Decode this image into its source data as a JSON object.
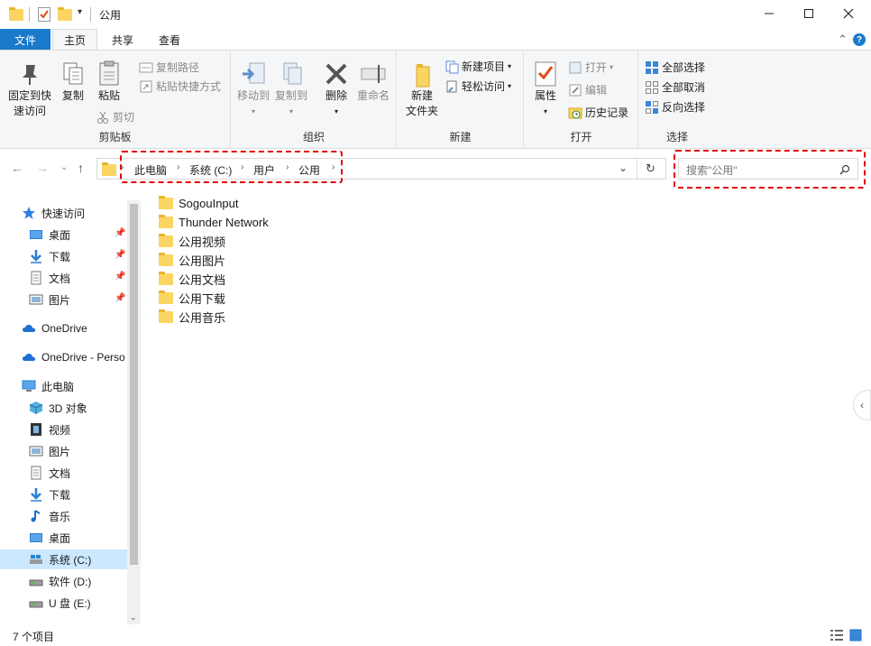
{
  "window": {
    "title": "公用"
  },
  "tabs": {
    "file": "文件",
    "home": "主页",
    "share": "共享",
    "view": "查看"
  },
  "ribbon": {
    "clipboard": {
      "label": "剪贴板",
      "pin_quick_line1": "固定到快",
      "pin_quick_line2": "速访问",
      "copy": "复制",
      "paste": "粘贴",
      "copy_path": "复制路径",
      "paste_shortcut": "粘贴快捷方式",
      "cut": "剪切"
    },
    "organize": {
      "label": "组织",
      "move_to": "移动到",
      "copy_to": "复制到",
      "delete": "删除",
      "rename": "重命名"
    },
    "new": {
      "label": "新建",
      "new_folder_line1": "新建",
      "new_folder_line2": "文件夹",
      "new_item": "新建项目",
      "easy_access": "轻松访问"
    },
    "open": {
      "label": "打开",
      "properties": "属性",
      "open": "打开",
      "edit": "编辑",
      "history": "历史记录"
    },
    "select": {
      "label": "选择",
      "select_all": "全部选择",
      "select_none": "全部取消",
      "invert": "反向选择"
    }
  },
  "address": {
    "crumbs": [
      "此电脑",
      "系统 (C:)",
      "用户",
      "公用"
    ],
    "search_placeholder": "搜索\"公用\""
  },
  "sidebar": {
    "quick_access": "快速访问",
    "quick_items": [
      "桌面",
      "下载",
      "文档",
      "图片"
    ],
    "onedrive": "OneDrive",
    "onedrive_personal": "OneDrive - Perso",
    "this_pc": "此电脑",
    "pc_items": [
      "3D 对象",
      "视频",
      "图片",
      "文档",
      "下载",
      "音乐",
      "桌面",
      "系统 (C:)",
      "软件 (D:)",
      "U 盘 (E:)"
    ]
  },
  "files": [
    "SogouInput",
    "Thunder Network",
    "公用视频",
    "公用图片",
    "公用文档",
    "公用下载",
    "公用音乐"
  ],
  "status": {
    "item_count": "7 个项目"
  },
  "colors": {
    "accent": "#1979ca",
    "highlight": "#e00000",
    "selected": "#cce8ff",
    "folder": "#fcd462"
  }
}
